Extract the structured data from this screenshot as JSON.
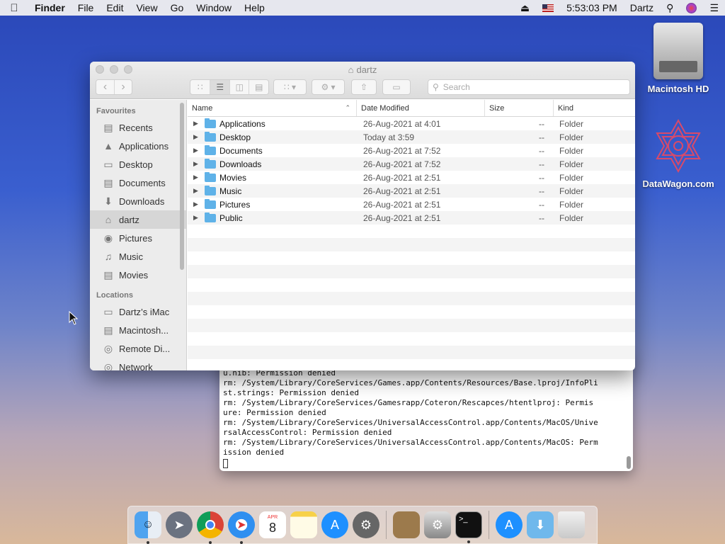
{
  "menubar": {
    "app": "Finder",
    "items": [
      "File",
      "Edit",
      "View",
      "Go",
      "Window",
      "Help"
    ],
    "clock": "5:53:03 PM",
    "user": "Dartz"
  },
  "desktop": {
    "icons": [
      {
        "label": "Macintosh HD",
        "icon": "hard-drive-icon"
      },
      {
        "label": "DataWagon.com",
        "icon": "datawagon-logo-icon"
      }
    ]
  },
  "finder": {
    "title": "dartz",
    "search_placeholder": "Search",
    "sidebar": {
      "favourites_heading": "Favourites",
      "favourites": [
        {
          "label": "Recents",
          "icon": "recents-icon"
        },
        {
          "label": "Applications",
          "icon": "applications-icon"
        },
        {
          "label": "Desktop",
          "icon": "desktop-icon"
        },
        {
          "label": "Documents",
          "icon": "documents-icon"
        },
        {
          "label": "Downloads",
          "icon": "downloads-icon"
        },
        {
          "label": "dartz",
          "icon": "home-icon",
          "selected": true
        },
        {
          "label": "Pictures",
          "icon": "camera-icon"
        },
        {
          "label": "Music",
          "icon": "music-icon"
        },
        {
          "label": "Movies",
          "icon": "film-icon"
        }
      ],
      "locations_heading": "Locations",
      "locations": [
        {
          "label": "Dartz’s iMac",
          "icon": "imac-icon"
        },
        {
          "label": "Macintosh...",
          "icon": "disk-icon"
        },
        {
          "label": "Remote Di...",
          "icon": "optical-disc-icon"
        },
        {
          "label": "Network",
          "icon": "network-icon"
        }
      ]
    },
    "columns": {
      "name": "Name",
      "date": "Date Modified",
      "size": "Size",
      "kind": "Kind"
    },
    "rows": [
      {
        "name": "Applications",
        "date": "26-Aug-2021 at 4:01",
        "size": "--",
        "kind": "Folder"
      },
      {
        "name": "Desktop",
        "date": "Today at 3:59",
        "size": "--",
        "kind": "Folder"
      },
      {
        "name": "Documents",
        "date": "26-Aug-2021 at 7:52",
        "size": "--",
        "kind": "Folder"
      },
      {
        "name": "Downloads",
        "date": "26-Aug-2021 at 7:52",
        "size": "--",
        "kind": "Folder"
      },
      {
        "name": "Movies",
        "date": "26-Aug-2021 at 2:51",
        "size": "--",
        "kind": "Folder"
      },
      {
        "name": "Music",
        "date": "26-Aug-2021 at 2:51",
        "size": "--",
        "kind": "Folder"
      },
      {
        "name": "Pictures",
        "date": "26-Aug-2021 at 2:51",
        "size": "--",
        "kind": "Folder"
      },
      {
        "name": "Public",
        "date": "26-Aug-2021 at 2:51",
        "size": "--",
        "kind": "Folder"
      }
    ]
  },
  "terminal": {
    "lines": [
      "u.nib: Permission denied",
      "rm: /System/Library/CoreServices/Games.app/Contents/Resources/Base.lproj/InfoPli",
      "st.strings: Permission denied",
      "rm: /System/Library/CoreServices/Gamesrapp/Coteron/Rescapces/htentlproj: Permis",
      "ure: Permission denied",
      "rm: /System/Library/CoreServices/UniversalAccessControl.app/Contents/MacOS/Unive",
      "rsalAccessControl: Permission denied",
      "rm: /System/Library/CoreServices/UniversalAccessControl.app/Contents/MacOS: Perm",
      "ission denied"
    ]
  },
  "dock": {
    "calendar_day": "8",
    "calendar_month": "APR",
    "apps": [
      "finder-icon",
      "launchpad-icon",
      "chrome-icon",
      "safari-icon",
      "calendar-icon",
      "notes-icon",
      "app-store-icon",
      "system-preferences-icon",
      "contacts-icon",
      "disk-utility-icon",
      "terminal-icon",
      "app-store-downloads-icon",
      "downloads-folder-icon",
      "trash-icon"
    ]
  }
}
